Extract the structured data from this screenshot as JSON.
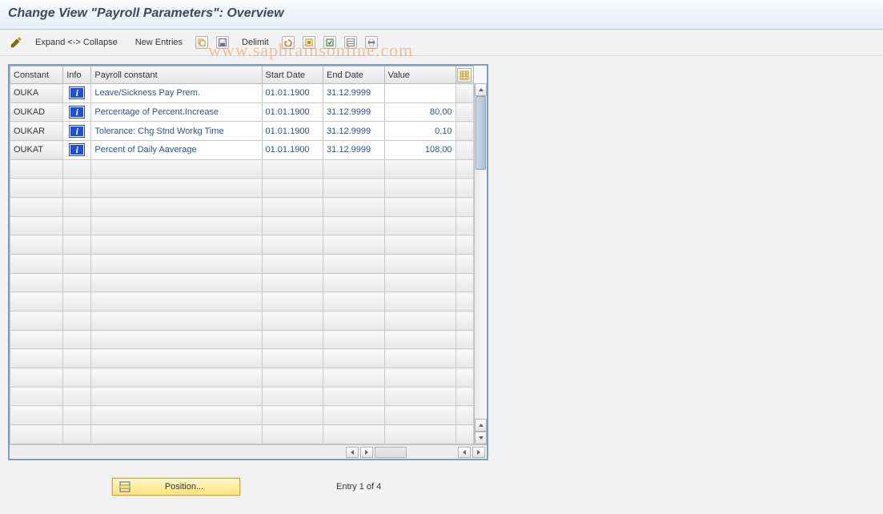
{
  "title": "Change View \"Payroll Parameters\": Overview",
  "watermark": "www.sapbrainsonline.com",
  "toolbar": {
    "expand_collapse": "Expand <-> Collapse",
    "new_entries": "New Entries",
    "delimit": "Delimit"
  },
  "columns": {
    "constant": "Constant",
    "info": "Info",
    "payroll_constant": "Payroll constant",
    "start_date": "Start Date",
    "end_date": "End Date",
    "value": "Value"
  },
  "rows": [
    {
      "constant": "OUKA",
      "payroll_constant": "Leave/Sickness Pay Prem.",
      "start": "01.01.1900",
      "end": "31.12.9999",
      "value": ""
    },
    {
      "constant": "OUKAD",
      "payroll_constant": "Percentage of Percent.Increase",
      "start": "01.01.1900",
      "end": "31.12.9999",
      "value": "80,00"
    },
    {
      "constant": "OUKAR",
      "payroll_constant": "Tolerance: Chg Stnd Workg Time",
      "start": "01.01.1900",
      "end": "31.12.9999",
      "value": "0,10"
    },
    {
      "constant": "OUKAT",
      "payroll_constant": "Percent of Daily Aaverage",
      "start": "01.01.1900",
      "end": "31.12.9999",
      "value": "108,00"
    }
  ],
  "blank_row_count": 15,
  "footer": {
    "position_label": "Position...",
    "entry_text": "Entry 1 of 4"
  },
  "info_glyph": "i"
}
